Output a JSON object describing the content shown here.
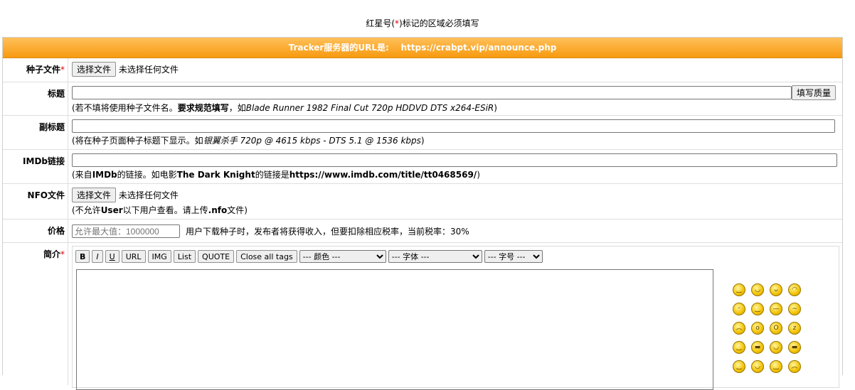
{
  "notice": {
    "before": "红星号(",
    "star": "*",
    "after": ")标记的区域必须填写"
  },
  "tracker": {
    "label": "Tracker服务器的URL是:",
    "url": "https://crabpt.vip/announce.php"
  },
  "torrent_file": {
    "label": "种子文件",
    "required": "*",
    "button": "选择文件",
    "status": "未选择任何文件"
  },
  "title": {
    "label": "标题",
    "button": "填写质量",
    "hint_prefix": "(若不填将使用种子文件名。",
    "hint_bold": "要求规范填写",
    "hint_mid": "，如",
    "hint_example": "Blade Runner 1982 Final Cut 720p HDDVD DTS x264-ESiR",
    "hint_suffix": ")"
  },
  "subtitle": {
    "label": "副标题",
    "hint_prefix": "(将在种子页面种子标题下显示。如",
    "hint_example": "银翼杀手 720p @ 4615 kbps - DTS 5.1 @ 1536 kbps",
    "hint_suffix": ")"
  },
  "imdb": {
    "label": "IMDb链接",
    "hint_1": "(来自",
    "hint_b1": "IMDb",
    "hint_2": "的链接。如电影",
    "hint_b2": "The Dark Knight",
    "hint_3": "的链接是",
    "hint_b3": "https://www.imdb.com/title/tt0468569/",
    "hint_4": ")"
  },
  "nfo": {
    "label": "NFO文件",
    "button": "选择文件",
    "status": "未选择任何文件",
    "hint_1": "(不允许",
    "hint_b1": "User",
    "hint_2": "以下用户查看。请上传",
    "hint_b2": ".nfo",
    "hint_3": "文件)"
  },
  "price": {
    "label": "价格",
    "placeholder": "允许最大值：1000000",
    "hint": "用户下载种子时，发布者将获得收入，但要扣除相应税率，当前税率：30%"
  },
  "intro": {
    "label": "简介",
    "required": "*",
    "toolbar": [
      "B",
      "I",
      "U",
      "URL",
      "IMG",
      "List",
      "QUOTE",
      "Close all tags"
    ],
    "color_select": "--- 颜色 ---",
    "font_select": "--- 字体 ---",
    "size_select": "--- 字号 ---"
  },
  "smilies": [
    "smile-icon",
    "grin-icon",
    "laugh-icon",
    "big-laugh-icon",
    "tongue-icon",
    "wink-icon",
    "neutral-icon",
    "confused-icon",
    "sad-icon",
    "shocked-icon",
    "surprised-icon",
    "sleepy-icon",
    "angel-icon",
    "cool-icon",
    "happy-icon",
    "sunglasses-icon",
    "thumbs-up-icon",
    "blush-icon",
    "smirk-icon",
    "worried-icon"
  ]
}
